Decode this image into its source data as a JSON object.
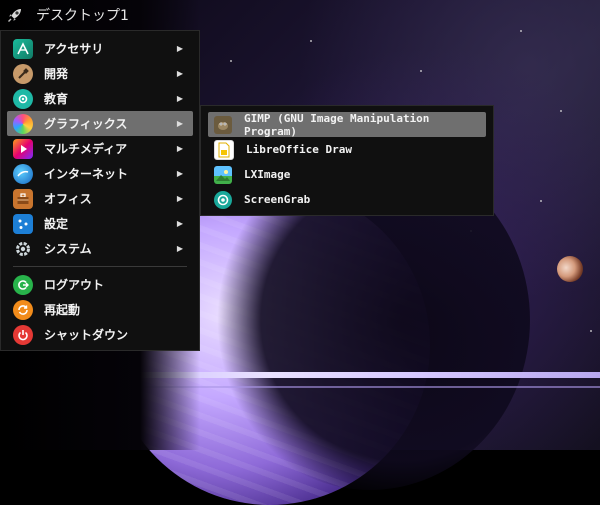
{
  "panel": {
    "title": "デスクトップ1",
    "icon": "rocket-icon"
  },
  "menu": {
    "items": [
      {
        "label": "アクセサリ",
        "icon": "accessories-icon",
        "has_submenu": true
      },
      {
        "label": "開発",
        "icon": "development-icon",
        "has_submenu": true
      },
      {
        "label": "教育",
        "icon": "education-icon",
        "has_submenu": true
      },
      {
        "label": "グラフィックス",
        "icon": "graphics-icon",
        "has_submenu": true,
        "active": true
      },
      {
        "label": "マルチメディア",
        "icon": "multimedia-icon",
        "has_submenu": true
      },
      {
        "label": "インターネット",
        "icon": "internet-icon",
        "has_submenu": true
      },
      {
        "label": "オフィス",
        "icon": "office-icon",
        "has_submenu": true
      },
      {
        "label": "設定",
        "icon": "settings-icon",
        "has_submenu": true
      },
      {
        "label": "システム",
        "icon": "system-icon",
        "has_submenu": true
      }
    ],
    "actions": [
      {
        "label": "ログアウト",
        "icon": "logout-icon"
      },
      {
        "label": "再起動",
        "icon": "reboot-icon"
      },
      {
        "label": "シャットダウン",
        "icon": "shutdown-icon"
      }
    ],
    "arrow": "▶"
  },
  "submenu": {
    "items": [
      {
        "label": "GIMP (GNU Image Manipulation Program)",
        "icon": "gimp-icon",
        "active": true
      },
      {
        "label": "LibreOffice Draw",
        "icon": "libreoffice-draw-icon"
      },
      {
        "label": "LXImage",
        "icon": "lximage-icon"
      },
      {
        "label": "ScreenGrab",
        "icon": "screengrab-icon"
      }
    ]
  },
  "colors": {
    "menu_bg": "#101010",
    "highlight": "#6f6f6f",
    "text": "#f2f2f2"
  }
}
